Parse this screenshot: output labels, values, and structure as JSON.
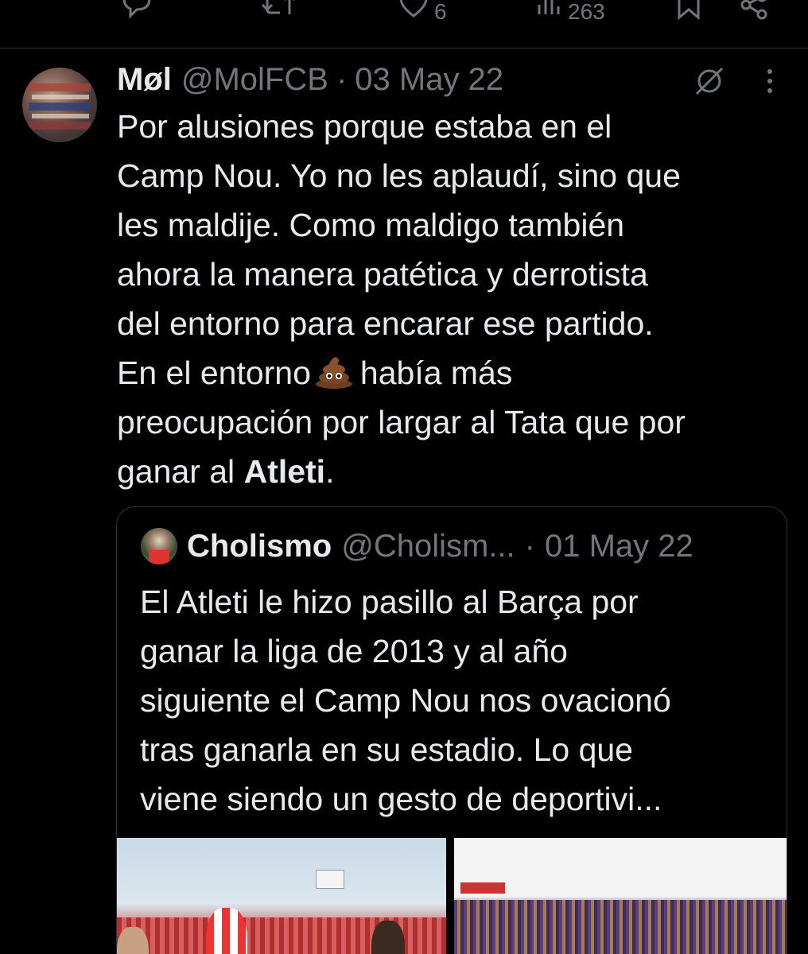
{
  "action_bar": {
    "likes": "6",
    "views": "263"
  },
  "tweet": {
    "display_name": "Møl",
    "handle": "@MolFCB",
    "separator": "·",
    "date": "03 May 22",
    "lines": [
      "Por alusiones porque estaba en el",
      "Camp Nou. Yo no les aplaudí, sino que",
      "les maldije. Como maldigo también",
      "ahora la manera patética y derrotista",
      "del entorno para encarar ese partido."
    ],
    "line6_before_emoji": "En el entorno",
    "line6_after_emoji": "había más",
    "line7": "preocupación por largar al Tata que por",
    "line8_before_bold": "ganar al ",
    "line8_bold": "Atleti",
    "line8_after_bold": "."
  },
  "quote": {
    "display_name": "Cholismo",
    "handle": "@Cholism...",
    "separator": "·",
    "date": "01 May 22",
    "lines": [
      "El Atleti le hizo pasillo al Barça por",
      "ganar la liga de 2013 y al año",
      "siguiente el Camp Nou nos ovacionó",
      "tras ganarla en su estadio. Lo que",
      "viene siendo un gesto de deportivi..."
    ]
  },
  "icons": {
    "reply": "reply-icon",
    "retweet": "retweet-icon",
    "like": "heart-icon",
    "views": "views-icon",
    "bookmark": "bookmark-icon",
    "share": "share-icon",
    "grok": "grok-icon",
    "more": "more-icon",
    "emoji": "poop-emoji"
  },
  "colors": {
    "background": "#000000",
    "primary_text": "#e7e9ea",
    "secondary_text": "#71767b",
    "border": "#2f3336"
  }
}
